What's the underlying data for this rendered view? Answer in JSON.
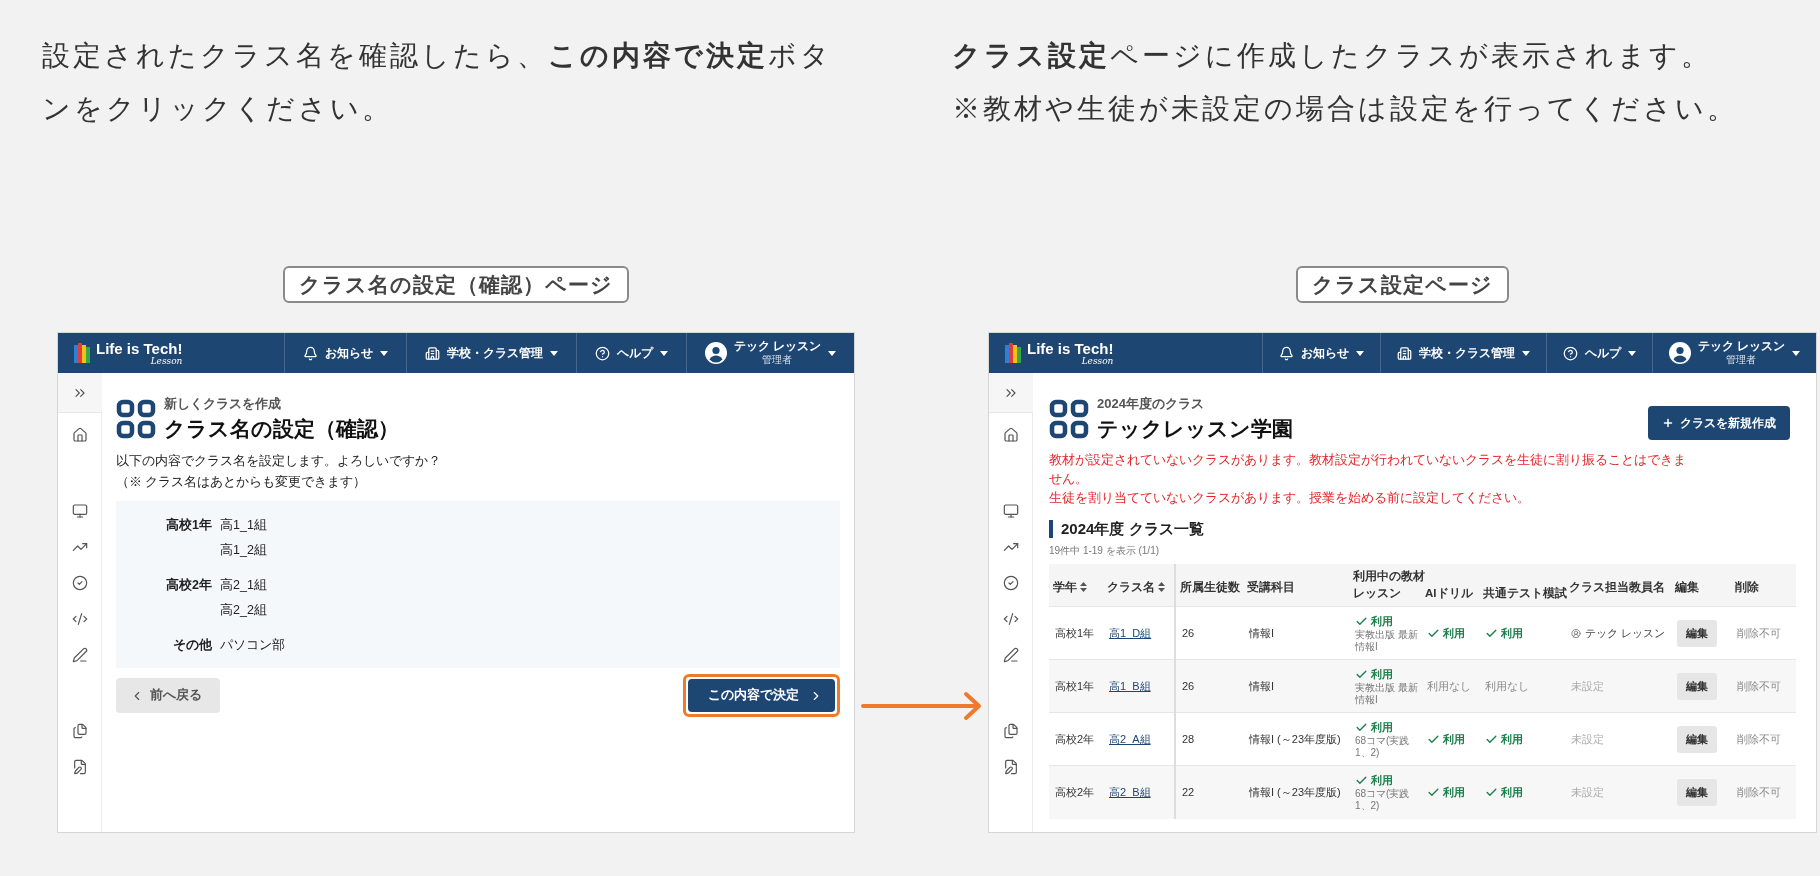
{
  "left_step": {
    "instruction": "設定されたクラス名を確認したら、**この内容で決定**ボタンをクリックください。",
    "page_label": "クラス名の設定（確認）ページ",
    "screen": {
      "header": {
        "logo": "Life is Tech!",
        "logo_sub": "Lesson",
        "nav": [
          {
            "label": "お知らせ"
          },
          {
            "label": "学校・クラス管理"
          },
          {
            "label": "ヘルプ"
          }
        ],
        "user": {
          "name": "テック レッスン",
          "role": "管理者"
        }
      },
      "subtitle": "新しくクラスを作成",
      "title": "クラス名の設定（確認）",
      "messages": [
        "以下の内容でクラス名を設定します。よろしいですか？",
        "（※ クラス名はあとからも変更できます）"
      ],
      "groups": [
        {
          "grade": "高校1年",
          "classes": [
            "高1_1組",
            "高1_2組"
          ]
        },
        {
          "grade": "高校2年",
          "classes": [
            "高2_1組",
            "高2_2組"
          ]
        },
        {
          "grade": "その他",
          "classes": [
            "パソコン部"
          ]
        }
      ],
      "back_button": "前へ戻る",
      "confirm_button": {
        "label": "この内容で決定",
        "highlighted": true
      }
    }
  },
  "right_step": {
    "instruction": [
      "**クラス設定**ページに作成したクラスが表示されます。",
      "※教材や生徒が未設定の場合は設定を行ってください。"
    ],
    "page_label": "クラス設定ページ",
    "screen": {
      "header": {
        "logo": "Life is Tech!",
        "logo_sub": "Lesson",
        "nav": [
          {
            "label": "お知らせ"
          },
          {
            "label": "学校・クラス管理"
          },
          {
            "label": "ヘルプ"
          }
        ],
        "user": {
          "name": "テック レッスン",
          "role": "管理者"
        }
      },
      "subtitle": "2024年度のクラス",
      "title": "テックレッスン学園",
      "new_button": "クラスを新規作成",
      "warnings": [
        "教材が設定されていないクラスがあります。教材設定が行われていないクラスを生徒に割り振ることはできません。",
        "生徒を割り当てていないクラスがあります。授業を始める前に設定してください。"
      ],
      "section_title": "2024年度 クラス一覧",
      "count": "19件中 1-19 を表示 (1/1)",
      "table": {
        "columns": [
          {
            "label": "学年",
            "sortable": true
          },
          {
            "label": "クラス名",
            "sortable": true
          },
          {
            "label": "所属生徒数",
            "sortable": false
          },
          {
            "label": "受講科目",
            "sortable": false
          }
        ],
        "materials_group": "利用中の教材",
        "material_columns": [
          "レッスン",
          "AIドリル",
          "共通テスト模試"
        ],
        "tail_columns": [
          "クラス担当教員名",
          "編集",
          "削除"
        ],
        "rows": [
          {
            "grade": "高校1年",
            "class": "高1_D組",
            "students": "26",
            "subject": "情報I",
            "lesson": {
              "text": "利用",
              "used": true,
              "note": "実教出版 最新情報I"
            },
            "ai": {
              "text": "利用",
              "used": true
            },
            "mock": {
              "text": "利用",
              "used": true
            },
            "teacher": {
              "name": "テック レッスン",
              "assigned": true
            },
            "edit": "編集",
            "delete": "削除不可"
          },
          {
            "grade": "高校1年",
            "class": "高1_B組",
            "students": "26",
            "subject": "情報I",
            "lesson": {
              "text": "利用",
              "used": true,
              "note": "実教出版 最新情報I"
            },
            "ai": {
              "text": "利用なし",
              "used": false
            },
            "mock": {
              "text": "利用なし",
              "used": false
            },
            "teacher": {
              "name": "未設定",
              "assigned": false
            },
            "edit": "編集",
            "delete": "削除不可"
          },
          {
            "grade": "高校2年",
            "class": "高2_A組",
            "students": "28",
            "subject": "情報I (～23年度版)",
            "lesson": {
              "text": "利用",
              "used": true,
              "note": "68コマ(実践1、2)"
            },
            "ai": {
              "text": "利用",
              "used": true
            },
            "mock": {
              "text": "利用",
              "used": true
            },
            "teacher": {
              "name": "未設定",
              "assigned": false
            },
            "edit": "編集",
            "delete": "削除不可"
          },
          {
            "grade": "高校2年",
            "class": "高2_B組",
            "students": "22",
            "subject": "情報I (～23年度版)",
            "lesson": {
              "text": "利用",
              "used": true,
              "note": "68コマ(実践1、2)"
            },
            "ai": {
              "text": "利用",
              "used": true
            },
            "mock": {
              "text": "利用",
              "used": true
            },
            "teacher": {
              "name": "未設定",
              "assigned": false
            },
            "edit": "編集",
            "delete": "削除不可"
          }
        ]
      }
    }
  }
}
